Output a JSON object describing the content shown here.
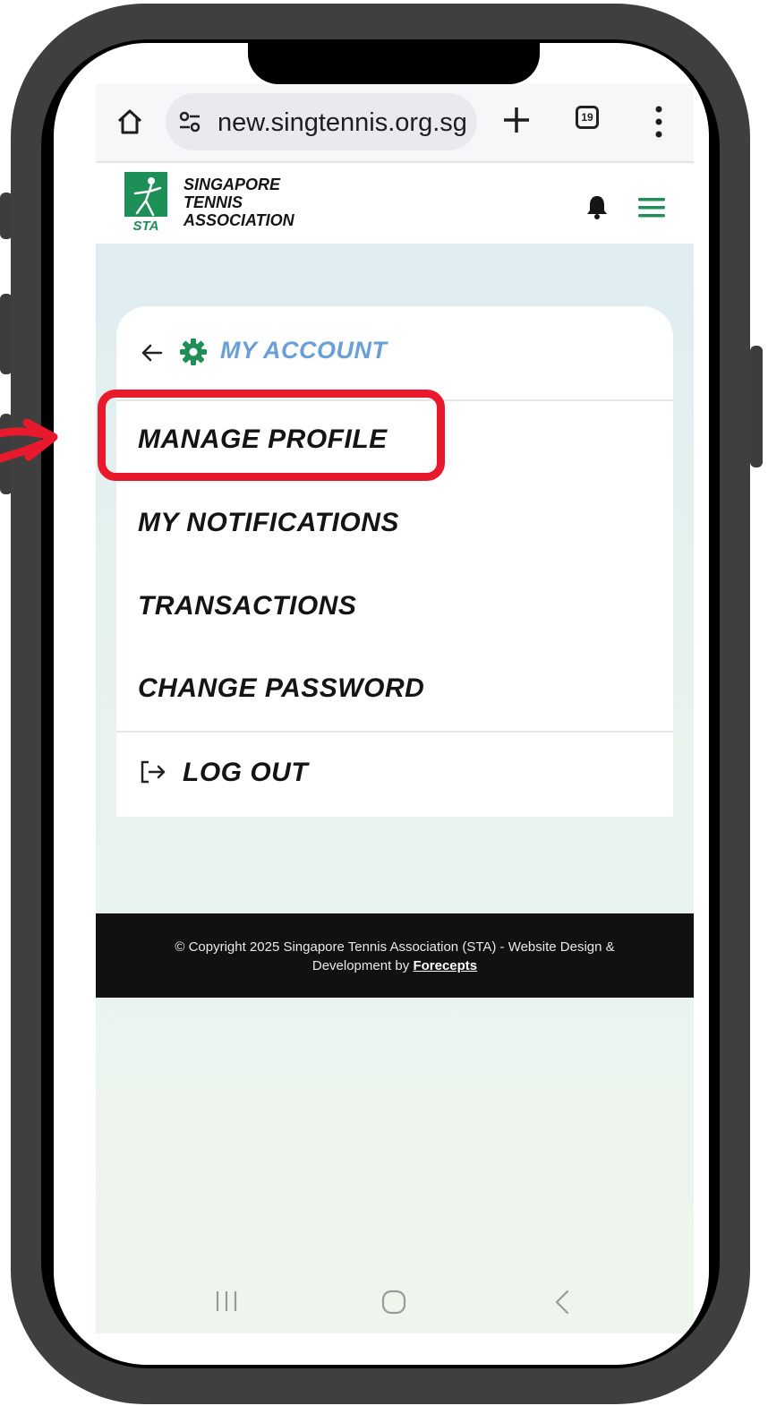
{
  "browser": {
    "url": "new.singtennis.org.sg",
    "tab_count": "19",
    "icons": [
      "home-icon",
      "site-settings-icon",
      "plus-icon",
      "tabs-icon",
      "more-vert-icon"
    ]
  },
  "site_header": {
    "logo_abbrev": "STA",
    "logo_line1": "SINGAPORE",
    "logo_line2": "TENNIS",
    "logo_line3": "ASSOCIATION",
    "icons": [
      "bell-icon",
      "hamburger-icon"
    ]
  },
  "account_menu": {
    "title": "MY ACCOUNT",
    "items": [
      {
        "label": "MANAGE PROFILE"
      },
      {
        "label": "MY NOTIFICATIONS"
      },
      {
        "label": "TRANSACTIONS"
      },
      {
        "label": "CHANGE PASSWORD"
      }
    ],
    "logout_label": "LOG OUT"
  },
  "footer": {
    "copyright": "© Copyright 2025 Singapore Tennis Association (STA) - Website Design &",
    "line2": "Development by",
    "link": "Forecepts"
  },
  "colors": {
    "brand_green": "#1e8f57",
    "title_blue": "#6a9fd8",
    "highlight_red": "#e8192c",
    "frame": "#3f3f3f"
  }
}
